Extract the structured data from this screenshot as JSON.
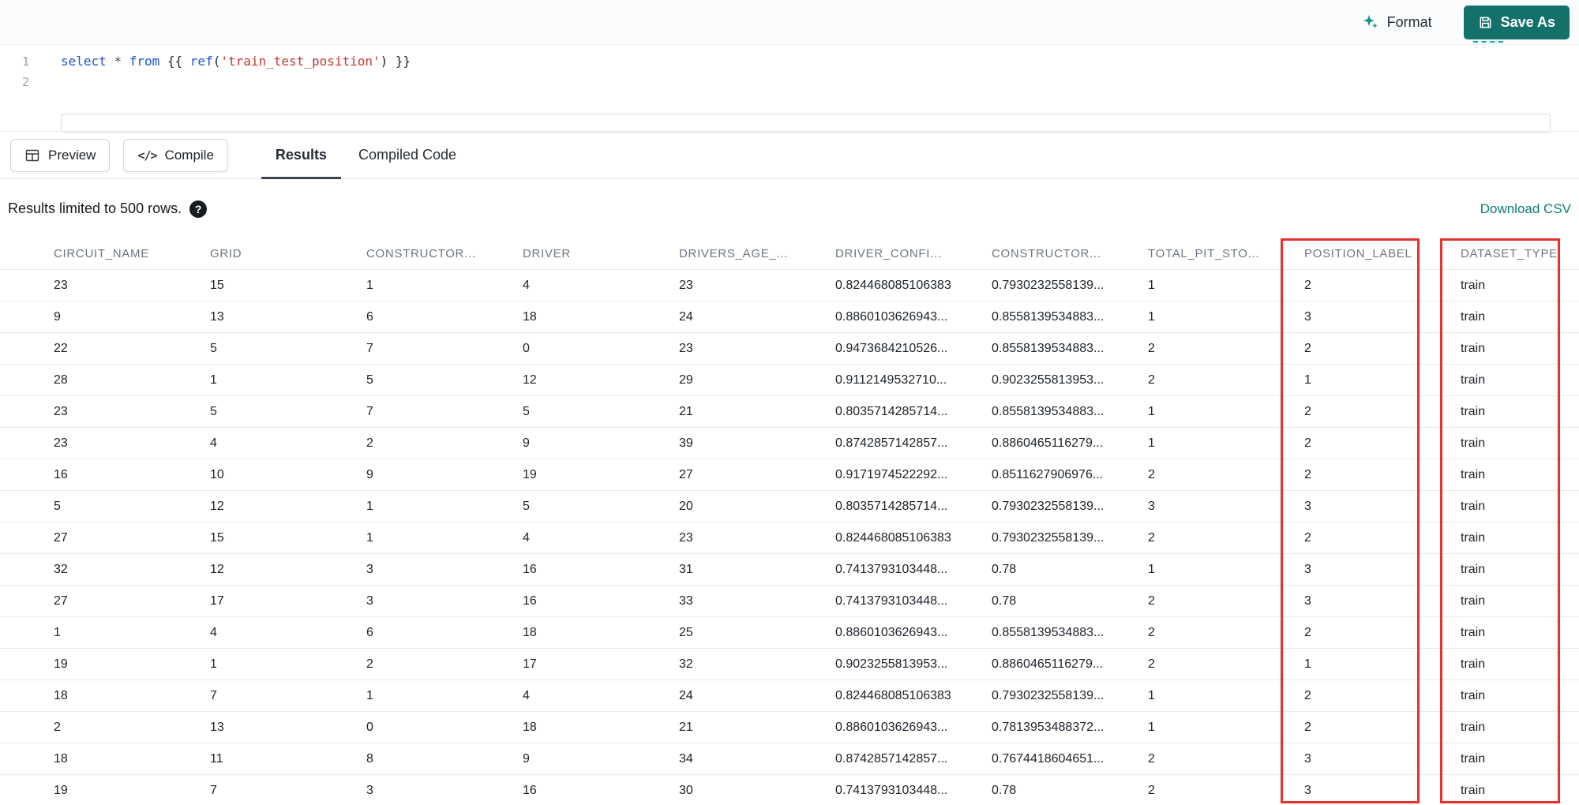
{
  "toolbar": {
    "format_label": "Format",
    "save_as_label": "Save As"
  },
  "editor": {
    "lines": [
      {
        "number": "1"
      },
      {
        "number": "2"
      }
    ],
    "code_tokens": [
      {
        "text": "select",
        "type": "keyword"
      },
      {
        "text": " ",
        "type": "punct"
      },
      {
        "text": "*",
        "type": "operator"
      },
      {
        "text": " ",
        "type": "punct"
      },
      {
        "text": "from",
        "type": "keyword"
      },
      {
        "text": " ",
        "type": "punct"
      },
      {
        "text": "{{ ",
        "type": "brace"
      },
      {
        "text": "ref",
        "type": "function"
      },
      {
        "text": "(",
        "type": "punct"
      },
      {
        "text": "'train_test_position'",
        "type": "string"
      },
      {
        "text": ")",
        "type": "punct"
      },
      {
        "text": " }}",
        "type": "brace"
      }
    ]
  },
  "actions": {
    "preview_label": "Preview",
    "compile_label": "Compile",
    "compile_icon_glyph": "</>"
  },
  "tabs": [
    {
      "label": "Results",
      "active": true
    },
    {
      "label": "Compiled Code",
      "active": false
    }
  ],
  "results_bar": {
    "limit_text": "Results limited to 500 rows.",
    "help_glyph": "?",
    "download_csv_label": "Download CSV"
  },
  "table": {
    "columns": [
      "CIRCUIT_NAME",
      "GRID",
      "CONSTRUCTOR...",
      "DRIVER",
      "DRIVERS_AGE_...",
      "DRIVER_CONFI...",
      "CONSTRUCTOR...",
      "TOTAL_PIT_STO...",
      "POSITION_LABEL",
      "DATASET_TYPE"
    ],
    "rows": [
      [
        "23",
        "15",
        "1",
        "4",
        "23",
        "0.824468085106383",
        "0.7930232558139...",
        "1",
        "2",
        "train"
      ],
      [
        "9",
        "13",
        "6",
        "18",
        "24",
        "0.8860103626943...",
        "0.8558139534883...",
        "1",
        "3",
        "train"
      ],
      [
        "22",
        "5",
        "7",
        "0",
        "23",
        "0.9473684210526...",
        "0.8558139534883...",
        "2",
        "2",
        "train"
      ],
      [
        "28",
        "1",
        "5",
        "12",
        "29",
        "0.9112149532710...",
        "0.9023255813953...",
        "2",
        "1",
        "train"
      ],
      [
        "23",
        "5",
        "7",
        "5",
        "21",
        "0.8035714285714...",
        "0.8558139534883...",
        "1",
        "2",
        "train"
      ],
      [
        "23",
        "4",
        "2",
        "9",
        "39",
        "0.8742857142857...",
        "0.8860465116279...",
        "1",
        "2",
        "train"
      ],
      [
        "16",
        "10",
        "9",
        "19",
        "27",
        "0.9171974522292...",
        "0.8511627906976...",
        "2",
        "2",
        "train"
      ],
      [
        "5",
        "12",
        "1",
        "5",
        "20",
        "0.8035714285714...",
        "0.7930232558139...",
        "3",
        "3",
        "train"
      ],
      [
        "27",
        "15",
        "1",
        "4",
        "23",
        "0.824468085106383",
        "0.7930232558139...",
        "2",
        "2",
        "train"
      ],
      [
        "32",
        "12",
        "3",
        "16",
        "31",
        "0.7413793103448...",
        "0.78",
        "1",
        "3",
        "train"
      ],
      [
        "27",
        "17",
        "3",
        "16",
        "33",
        "0.7413793103448...",
        "0.78",
        "2",
        "3",
        "train"
      ],
      [
        "1",
        "4",
        "6",
        "18",
        "25",
        "0.8860103626943...",
        "0.8558139534883...",
        "2",
        "2",
        "train"
      ],
      [
        "19",
        "1",
        "2",
        "17",
        "32",
        "0.9023255813953...",
        "0.8860465116279...",
        "2",
        "1",
        "train"
      ],
      [
        "18",
        "7",
        "1",
        "4",
        "24",
        "0.824468085106383",
        "0.7930232558139...",
        "1",
        "2",
        "train"
      ],
      [
        "2",
        "13",
        "0",
        "18",
        "21",
        "0.8860103626943...",
        "0.7813953488372...",
        "1",
        "2",
        "train"
      ],
      [
        "18",
        "11",
        "8",
        "9",
        "34",
        "0.8742857142857...",
        "0.7674418604651...",
        "2",
        "3",
        "train"
      ],
      [
        "19",
        "7",
        "3",
        "16",
        "30",
        "0.7413793103448...",
        "0.78",
        "2",
        "3",
        "train"
      ]
    ]
  },
  "annotations": {
    "highlight_color": "#e8312e",
    "highlighted_columns": [
      "POSITION_LABEL",
      "DATASET_TYPE"
    ]
  },
  "colors": {
    "accent_teal": "#13716a",
    "link_teal": "#0c7d73",
    "keyword_blue": "#1a53d6",
    "string_red": "#c4372e",
    "tab_underline": "#3d4450"
  }
}
